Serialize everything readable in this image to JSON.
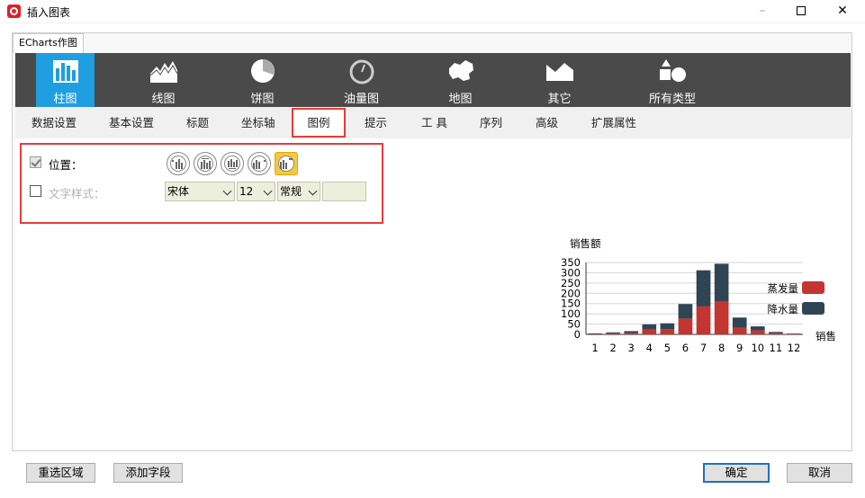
{
  "window": {
    "title": "插入图表"
  },
  "outer_tab": "ECharts作图",
  "chart_types": [
    {
      "label": "柱图",
      "icon": "bar-chart-icon",
      "active": true
    },
    {
      "label": "线图",
      "icon": "line-chart-icon",
      "active": false
    },
    {
      "label": "饼图",
      "icon": "pie-chart-icon",
      "active": false
    },
    {
      "label": "油量图",
      "icon": "gauge-icon",
      "active": false
    },
    {
      "label": "地图",
      "icon": "map-icon",
      "active": false
    },
    {
      "label": "其它",
      "icon": "area-shape-icon",
      "active": false
    },
    {
      "label": "所有类型",
      "icon": "shapes-icon",
      "active": false
    }
  ],
  "sub_tabs": [
    {
      "label": "数据设置"
    },
    {
      "label": "基本设置"
    },
    {
      "label": "标题"
    },
    {
      "label": "坐标轴"
    },
    {
      "label": "图例",
      "active": true
    },
    {
      "label": "提示"
    },
    {
      "label": "工 具"
    },
    {
      "label": "序列"
    },
    {
      "label": "高级"
    },
    {
      "label": "扩展属性"
    }
  ],
  "legend_settings": {
    "position_label": "位置：",
    "position_checked": true,
    "text_style_label": "文字样式：",
    "text_style_checked": false,
    "font_family": "宋体",
    "font_size": "12",
    "font_weight": "常规",
    "font_color": ""
  },
  "chart_data": {
    "type": "bar",
    "stacked": true,
    "title": "销售额",
    "categories": [
      "1",
      "2",
      "3",
      "4",
      "5",
      "6",
      "7",
      "8",
      "9",
      "10",
      "11",
      "12"
    ],
    "series": [
      {
        "name": "蒸发量",
        "color": "#c23531",
        "values": [
          2,
          5,
          7,
          23,
          25,
          77,
          136,
          162,
          33,
          20,
          6,
          3
        ]
      },
      {
        "name": "降水量",
        "color": "#2f4554",
        "values": [
          3,
          5,
          9,
          26,
          29,
          71,
          176,
          182,
          49,
          19,
          6,
          2
        ]
      }
    ],
    "ylim": [
      0,
      350
    ],
    "yticks": [
      "0",
      "50",
      "100",
      "150",
      "200",
      "250",
      "300",
      "350"
    ],
    "xlabel": "销售",
    "grid": true,
    "legend_position": "right"
  },
  "buttons": {
    "reselect": "重选区域",
    "add_field": "添加字段",
    "ok": "确定",
    "cancel": "取消"
  }
}
